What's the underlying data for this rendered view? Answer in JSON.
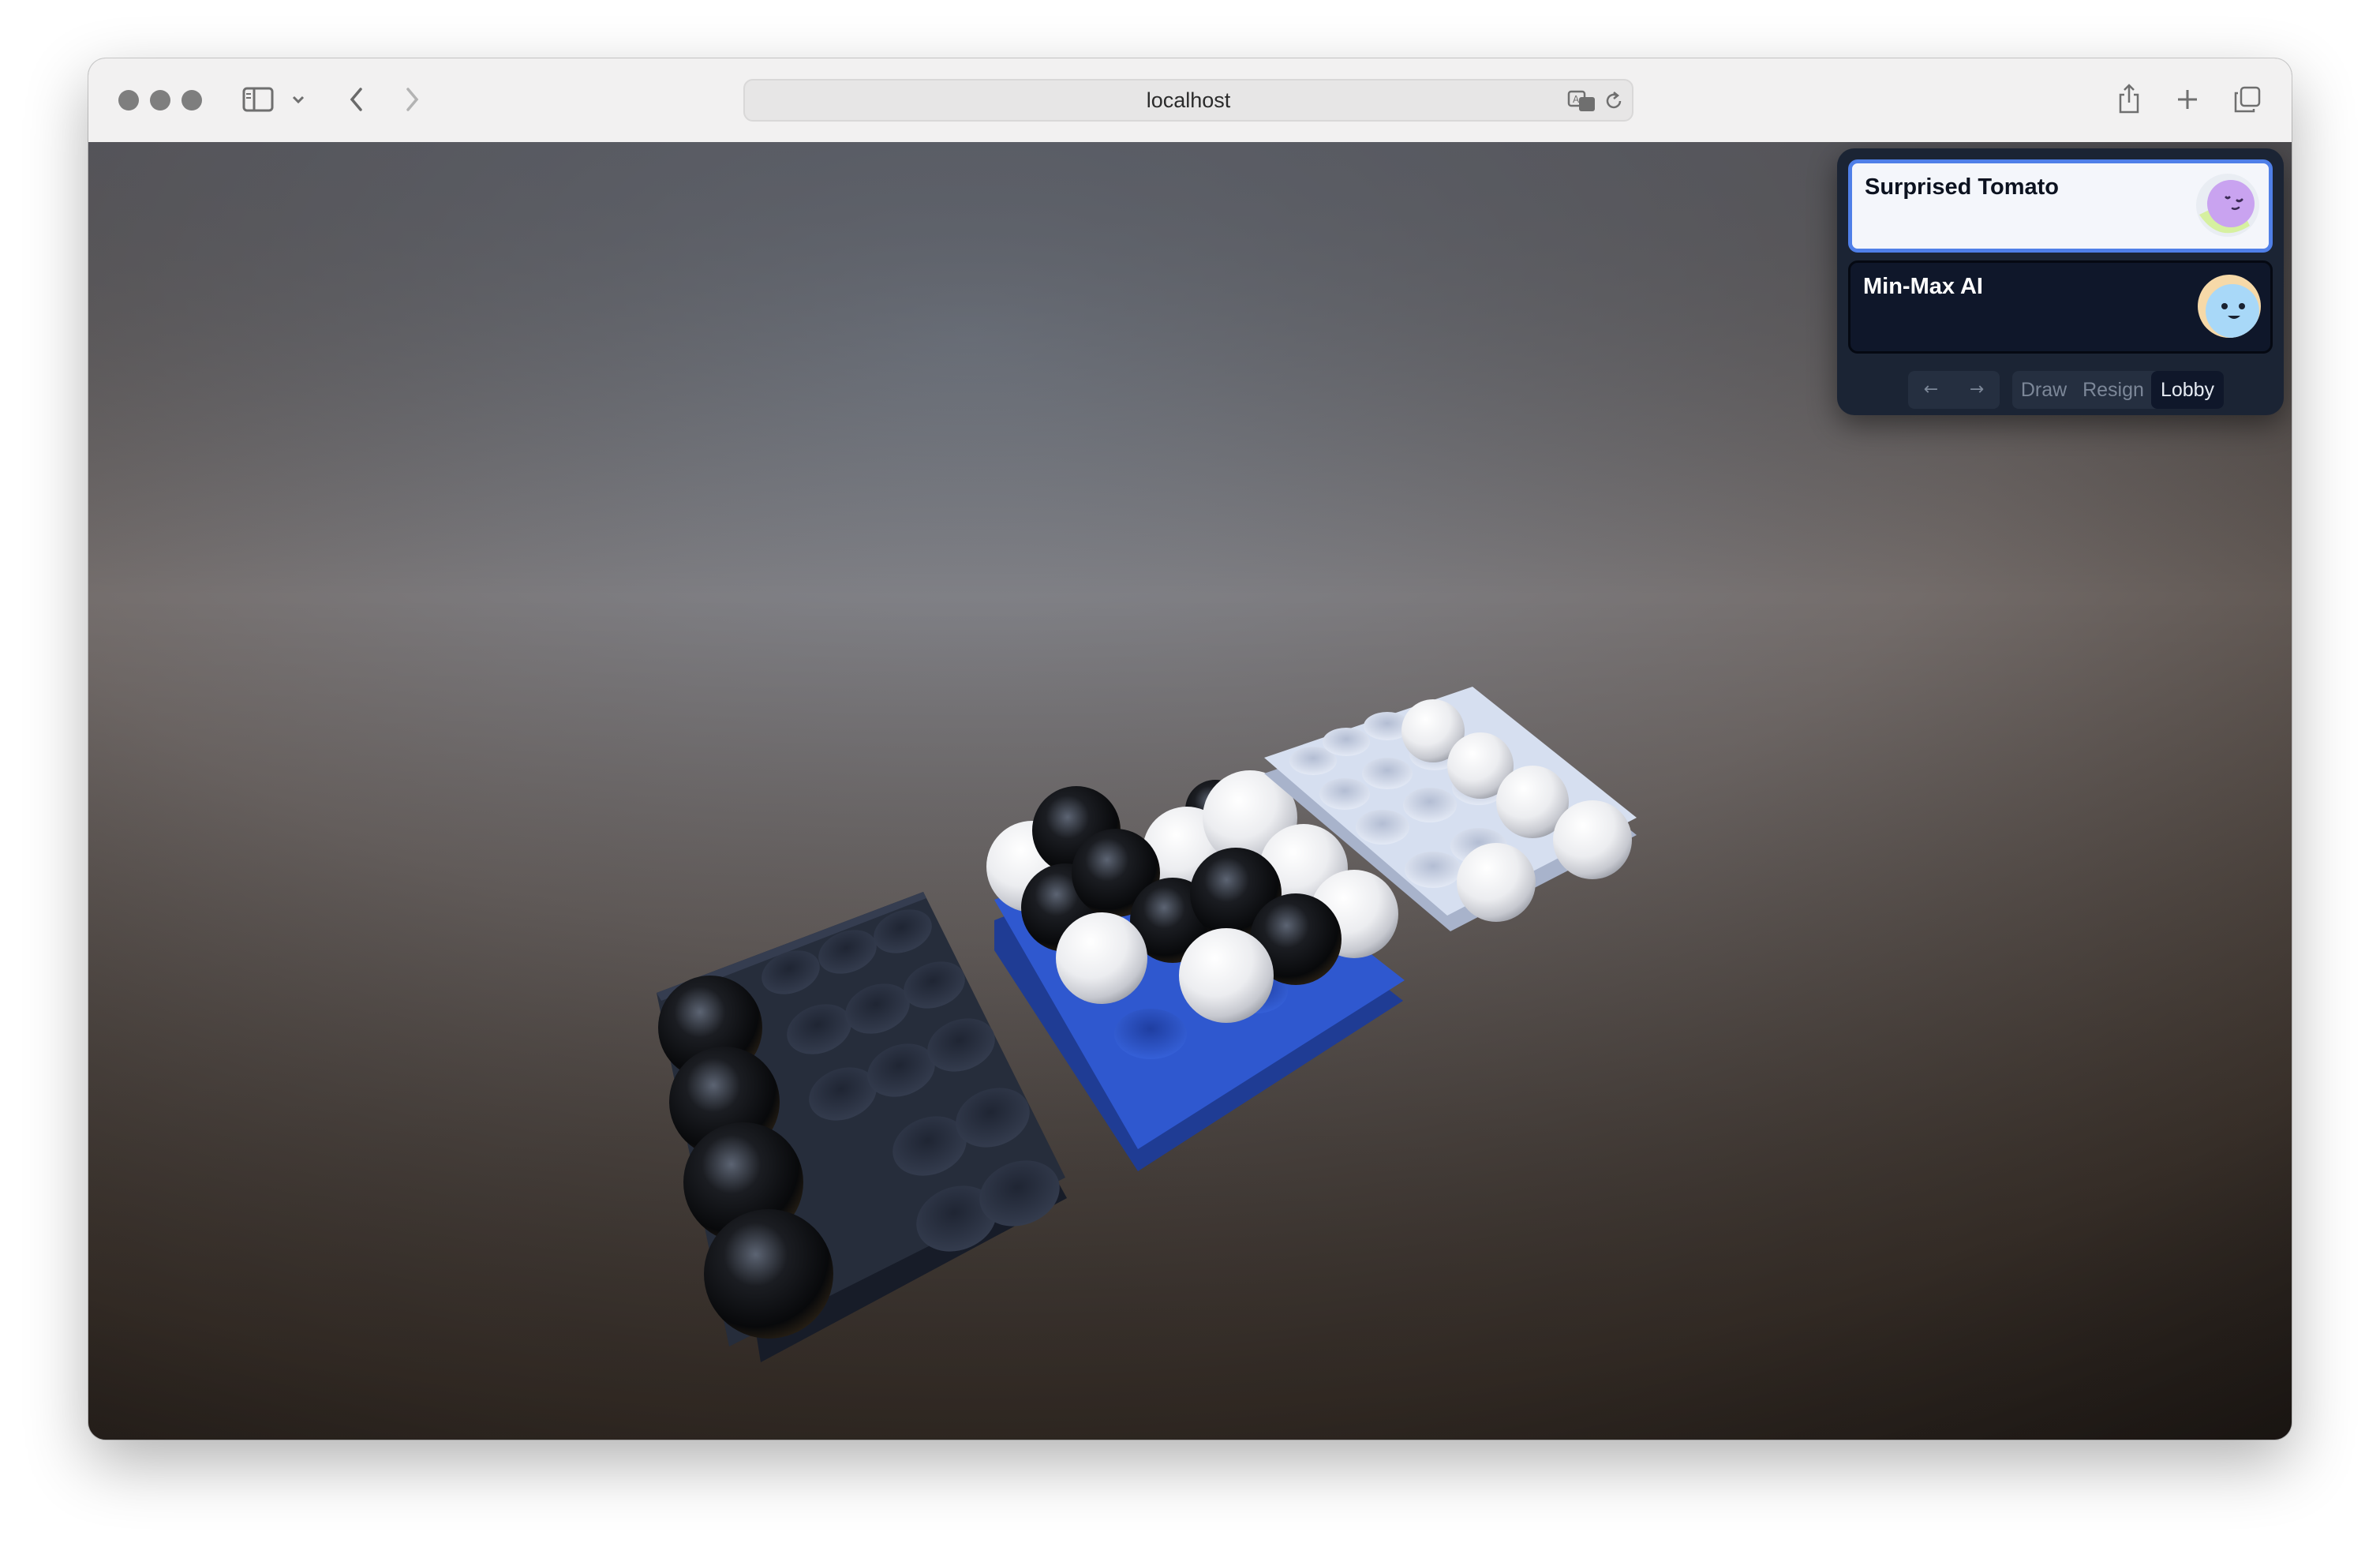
{
  "browser": {
    "url": "localhost",
    "icons": [
      "sidebar-icon",
      "chevron-down-icon",
      "back-icon",
      "forward-icon",
      "translate-icon",
      "reload-icon",
      "share-icon",
      "new-tab-icon",
      "tabs-overview-icon"
    ]
  },
  "game": {
    "players": [
      {
        "name": "Surprised Tomato",
        "active": true,
        "avatar_colors": [
          "#c9a3f0",
          "#d6f0a0"
        ]
      },
      {
        "name": "Min-Max AI",
        "active": false,
        "avatar_colors": [
          "#a8d8f8",
          "#f6d9a8"
        ]
      }
    ],
    "controls": {
      "prev": "←",
      "next": "→",
      "draw": "Draw",
      "resign": "Resign",
      "lobby": "Lobby"
    },
    "boards": [
      {
        "color": "#262d3b",
        "holds": "black spheres"
      },
      {
        "color": "#2f58cf",
        "holds": "black and white spheres"
      },
      {
        "color": "#d6dff0",
        "holds": "white spheres"
      }
    ],
    "colors": {
      "accent": "#4f7fe8",
      "panel": "#1b2434"
    }
  }
}
